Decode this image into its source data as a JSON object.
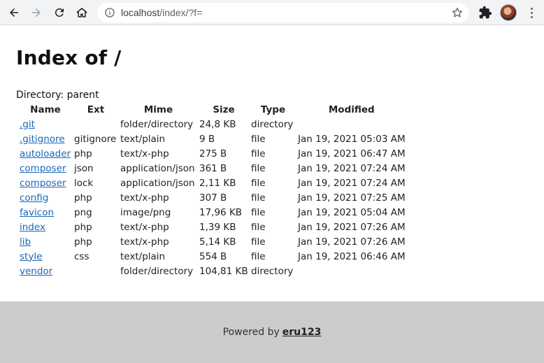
{
  "browser": {
    "url_host": "localhost",
    "url_path": "/index/?f="
  },
  "page": {
    "title": "Index of /",
    "directory_label": "Directory: parent"
  },
  "table": {
    "headers": [
      "Name",
      "Ext",
      "Mime",
      "Size",
      "Type",
      "Modified"
    ],
    "rows": [
      {
        "name": ".git",
        "ext": "",
        "mime": "folder/directory",
        "size": "24,8 KB",
        "type": "directory",
        "modified": ""
      },
      {
        "name": ".gitignore",
        "ext": "gitignore",
        "mime": "text/plain",
        "size": "9 B",
        "type": "file",
        "modified": "Jan 19, 2021 05:03 AM"
      },
      {
        "name": "autoloader",
        "ext": "php",
        "mime": "text/x-php",
        "size": "275 B",
        "type": "file",
        "modified": "Jan 19, 2021 06:47 AM"
      },
      {
        "name": "composer",
        "ext": "json",
        "mime": "application/json",
        "size": "361 B",
        "type": "file",
        "modified": "Jan 19, 2021 07:24 AM"
      },
      {
        "name": "composer",
        "ext": "lock",
        "mime": "application/json",
        "size": "2,11 KB",
        "type": "file",
        "modified": "Jan 19, 2021 07:24 AM"
      },
      {
        "name": "config",
        "ext": "php",
        "mime": "text/x-php",
        "size": "307 B",
        "type": "file",
        "modified": "Jan 19, 2021 07:25 AM"
      },
      {
        "name": "favicon",
        "ext": "png",
        "mime": "image/png",
        "size": "17,96 KB",
        "type": "file",
        "modified": "Jan 19, 2021 05:04 AM"
      },
      {
        "name": "index",
        "ext": "php",
        "mime": "text/x-php",
        "size": "1,39 KB",
        "type": "file",
        "modified": "Jan 19, 2021 07:26 AM"
      },
      {
        "name": "lib",
        "ext": "php",
        "mime": "text/x-php",
        "size": "5,14 KB",
        "type": "file",
        "modified": "Jan 19, 2021 07:26 AM"
      },
      {
        "name": "style",
        "ext": "css",
        "mime": "text/plain",
        "size": "554 B",
        "type": "file",
        "modified": "Jan 19, 2021 06:46 AM"
      },
      {
        "name": "vendor",
        "ext": "",
        "mime": "folder/directory",
        "size": "104,81 KB",
        "type": "directory",
        "modified": ""
      }
    ]
  },
  "footer": {
    "text": "Powered by",
    "link": "eru123"
  },
  "icons": {
    "back": "back-arrow-icon",
    "forward": "forward-arrow-icon",
    "reload": "reload-icon",
    "home": "home-icon",
    "info": "info-icon",
    "star": "star-icon",
    "extensions": "puzzle-icon",
    "menu": "kebab-menu-icon"
  },
  "colors": {
    "link": "#1a66b8",
    "footer_bg": "#cccccc",
    "toolbar_bg": "#f1f3f4"
  }
}
